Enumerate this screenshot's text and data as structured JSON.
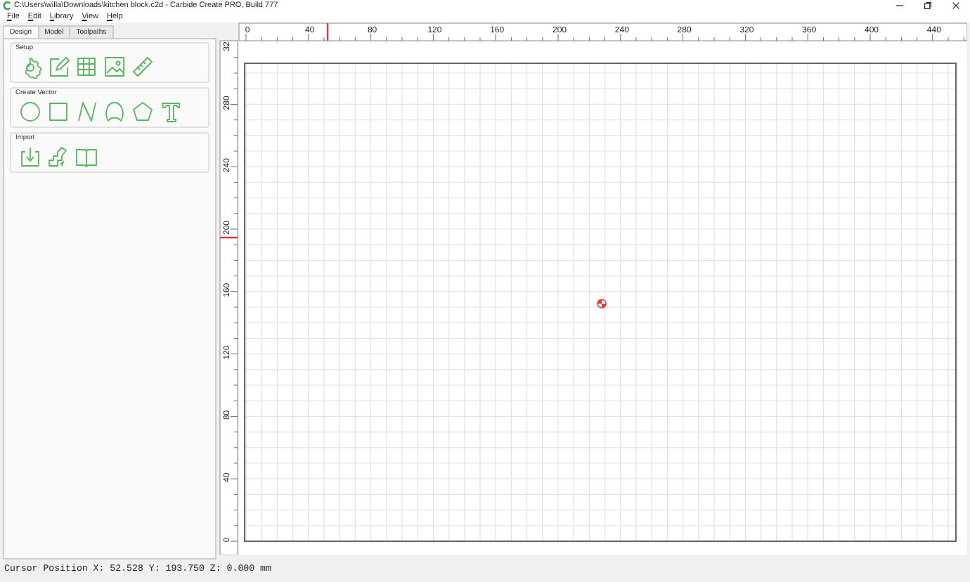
{
  "window": {
    "title": "C:\\Users\\willa\\Downloads\\kitchen block.c2d - Carbide Create PRO, Build 777"
  },
  "menu": [
    "File",
    "Edit",
    "Library",
    "View",
    "Help"
  ],
  "tabs": [
    {
      "label": "Design",
      "selected": true
    },
    {
      "label": "Model",
      "selected": false
    },
    {
      "label": "Toolpaths",
      "selected": false
    }
  ],
  "sections": [
    {
      "title": "Setup",
      "tools": [
        {
          "kind": "gear"
        },
        {
          "kind": "edit"
        },
        {
          "kind": "grid"
        },
        {
          "kind": "image"
        },
        {
          "kind": "ruler"
        }
      ]
    },
    {
      "title": "Create Vector",
      "tools": [
        {
          "kind": "circle"
        },
        {
          "kind": "rectangle"
        },
        {
          "kind": "polyline"
        },
        {
          "kind": "curve"
        },
        {
          "kind": "polygon"
        },
        {
          "kind": "text"
        }
      ]
    },
    {
      "title": "Import",
      "tools": [
        {
          "kind": "import"
        },
        {
          "kind": "steps"
        },
        {
          "kind": "book"
        }
      ]
    }
  ],
  "top_ruler": {
    "labels": [
      "0",
      "40",
      "80",
      "120",
      "160",
      "200",
      "240",
      "280",
      "320",
      "360",
      "400",
      "440"
    ]
  },
  "left_ruler": {
    "labels": [
      "32",
      "280",
      "240",
      "200",
      "160",
      "120",
      "80",
      "40",
      "0"
    ]
  },
  "status_bar": "Cursor Position X: 52.528 Y: 193.750 Z: 0.000 mm"
}
